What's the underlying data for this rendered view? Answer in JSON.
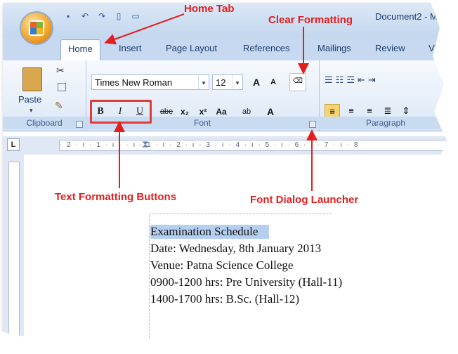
{
  "window": {
    "document_title": "Document2 - M"
  },
  "tabs": [
    {
      "label": "Home"
    },
    {
      "label": "Insert"
    },
    {
      "label": "Page Layout"
    },
    {
      "label": "References"
    },
    {
      "label": "Mailings"
    },
    {
      "label": "Review"
    },
    {
      "label": "View"
    }
  ],
  "clipboard": {
    "paste_label": "Paste",
    "group_label": "Clipboard"
  },
  "font": {
    "family": "Times New Roman",
    "size": "12",
    "group_label": "Font",
    "bold_label": "B",
    "italic_label": "I",
    "underline_label": "U",
    "strike_label": "abe",
    "subscript_label": "x₂",
    "superscript_label": "x²",
    "change_case_label": "Aa",
    "grow_label": "A",
    "shrink_label": "A",
    "highlight_label": "ab",
    "color_label": "A"
  },
  "paragraph": {
    "group_label": "Paragraph"
  },
  "ruler": {
    "corner_label": "L",
    "marks": "· 2 · ı · 1 · ı ·   · ı · 1 · ı · 2 · ı · 3 · ı · 4 · ı · 5 · ı · 6 · ı · 7 · ı · 8"
  },
  "document": {
    "lines": [
      "Examination Schedule",
      "Date: Wednesday, 8th January 2013",
      "Venue: Patna Science College",
      "0900-1200 hrs: Pre University (Hall-11)",
      "1400-1700 hrs: B.Sc. (Hall-12)"
    ]
  },
  "callouts": {
    "home_tab": "Home Tab",
    "clear_formatting": "Clear Formatting",
    "text_formatting": "Text Formatting Buttons",
    "font_dialog": "Font Dialog Launcher"
  },
  "colors": {
    "callout": "#e31e1e",
    "selection": "#b5cff0",
    "ribbon_blue": "#c6d9f0"
  }
}
